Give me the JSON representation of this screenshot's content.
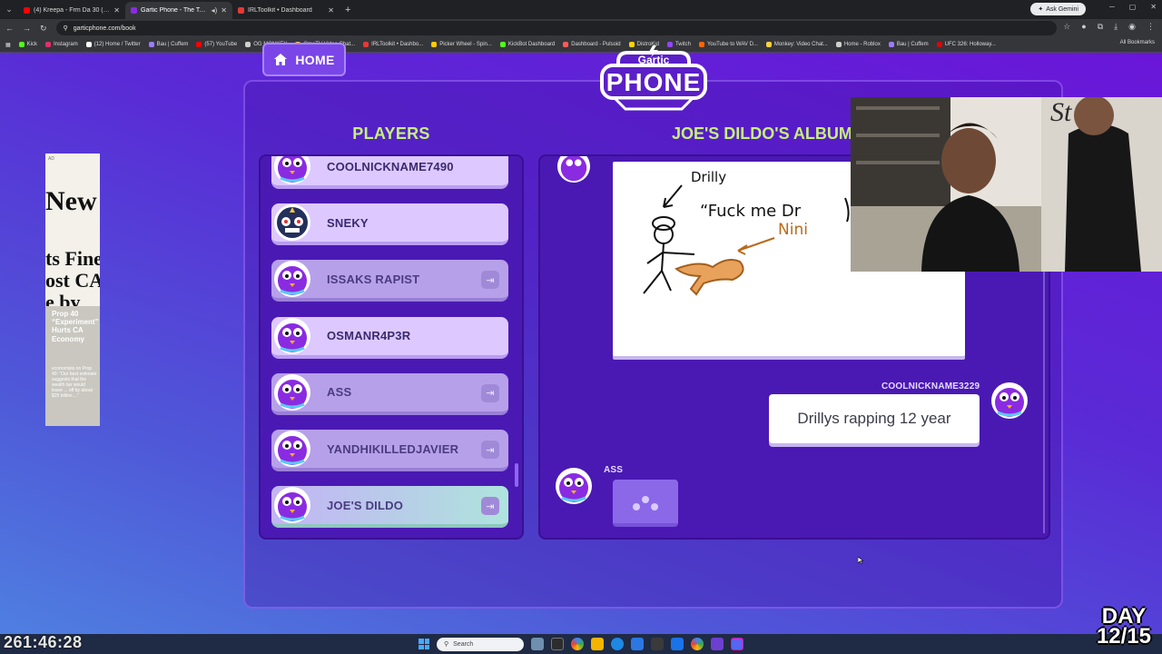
{
  "browser": {
    "tabs": [
      {
        "title": "(4) Kreepa - Frm Da 30 (Official",
        "color": "#ff0000",
        "active": false
      },
      {
        "title": "Gartic Phone - The Telephone",
        "color": "#8a2be2",
        "active": true
      },
      {
        "title": "IRLToolkit • Dashboard",
        "color": "#e53935",
        "active": false
      }
    ],
    "ask_gemini": "Ask Gemini",
    "url": "garticphone.com/book",
    "bookmarks": [
      {
        "label": "Kick",
        "color": "#53fc18"
      },
      {
        "label": "Instagram",
        "color": "#e1306c"
      },
      {
        "label": "(12) Home / Twitter",
        "color": "#ffffff"
      },
      {
        "label": "Bau | Cuffem",
        "color": "#9b7bff"
      },
      {
        "label": "(57) YouTube",
        "color": "#ff0000"
      },
      {
        "label": "OG MONKEY",
        "color": "#cfcfcf"
      },
      {
        "label": "OmeTV Video Chat...",
        "color": "#f4c542"
      },
      {
        "label": "IRLToolkit • Dashbo...",
        "color": "#e53935"
      },
      {
        "label": "Picker Wheel - Spin...",
        "color": "#ffcc00"
      },
      {
        "label": "KickBot Dashboard",
        "color": "#53fc18"
      },
      {
        "label": "Dashboard - Pulsoid",
        "color": "#ff5a5a"
      },
      {
        "label": "DistroKid",
        "color": "#ffd400"
      },
      {
        "label": "Twitch",
        "color": "#9146ff"
      },
      {
        "label": "YouTube to WAV D...",
        "color": "#ff6600"
      },
      {
        "label": "Monkey: Video Chat...",
        "color": "#ffd23f"
      },
      {
        "label": "Home - Roblox",
        "color": "#cfcfcf"
      },
      {
        "label": "Bau | Cuffem",
        "color": "#9b7bff"
      },
      {
        "label": "UFC 326: Holloway...",
        "color": "#d20a0a"
      }
    ],
    "all_bookmarks": "All Bookmarks"
  },
  "game": {
    "home_label": "HOME",
    "logo_top": "Gartic",
    "logo_bottom": "PHONE",
    "players_title": "PLAYERS",
    "album_title": "JOE'S DILDO'S ALBUM",
    "players": [
      {
        "name": "COOLNICKNAME7490",
        "status": "active"
      },
      {
        "name": "SNEKY",
        "status": "active"
      },
      {
        "name": "ISSAKS RAPIST",
        "status": "left"
      },
      {
        "name": "OSMANR4P3R",
        "status": "active"
      },
      {
        "name": "ASS",
        "status": "left"
      },
      {
        "name": "YANDHIKILLEDJAVIER",
        "status": "left"
      },
      {
        "name": "JOE'S DILDO",
        "status": "left"
      }
    ],
    "drawing_texts": {
      "label1": "Drilly",
      "label2": "“Fuck me Dr",
      "label3": "Nini"
    },
    "message": {
      "author": "COOLNICKNAME3229",
      "text": "Drillys rapping 12 year"
    },
    "typing": {
      "author": "ASS"
    }
  },
  "ad": {
    "mark": "AD",
    "masthead": "New York",
    "headline_1": "ts Fine",
    "headline_2": "ost CA",
    "headline_3": "e by",
    "promo": "Prop 40 “Experiment” Hurts CA Economy",
    "small": "economists on Prop 40: “Our best estimate suggests that the wealth tax would leave ... off by about $25 billion ...”"
  },
  "overlay": {
    "timer": "261:46:28",
    "day_top": "DAY",
    "day_bottom": "12/15"
  },
  "taskbar": {
    "search_placeholder": "Search"
  }
}
